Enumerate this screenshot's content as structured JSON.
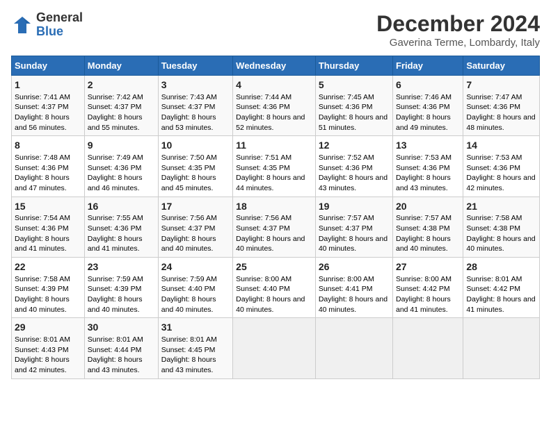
{
  "logo": {
    "general": "General",
    "blue": "Blue"
  },
  "title": "December 2024",
  "subtitle": "Gaverina Terme, Lombardy, Italy",
  "days_header": [
    "Sunday",
    "Monday",
    "Tuesday",
    "Wednesday",
    "Thursday",
    "Friday",
    "Saturday"
  ],
  "weeks": [
    [
      {
        "day": "1",
        "sunrise": "7:41 AM",
        "sunset": "4:37 PM",
        "daylight": "8 hours and 56 minutes."
      },
      {
        "day": "2",
        "sunrise": "7:42 AM",
        "sunset": "4:37 PM",
        "daylight": "8 hours and 55 minutes."
      },
      {
        "day": "3",
        "sunrise": "7:43 AM",
        "sunset": "4:37 PM",
        "daylight": "8 hours and 53 minutes."
      },
      {
        "day": "4",
        "sunrise": "7:44 AM",
        "sunset": "4:36 PM",
        "daylight": "8 hours and 52 minutes."
      },
      {
        "day": "5",
        "sunrise": "7:45 AM",
        "sunset": "4:36 PM",
        "daylight": "8 hours and 51 minutes."
      },
      {
        "day": "6",
        "sunrise": "7:46 AM",
        "sunset": "4:36 PM",
        "daylight": "8 hours and 49 minutes."
      },
      {
        "day": "7",
        "sunrise": "7:47 AM",
        "sunset": "4:36 PM",
        "daylight": "8 hours and 48 minutes."
      }
    ],
    [
      {
        "day": "8",
        "sunrise": "7:48 AM",
        "sunset": "4:36 PM",
        "daylight": "8 hours and 47 minutes."
      },
      {
        "day": "9",
        "sunrise": "7:49 AM",
        "sunset": "4:36 PM",
        "daylight": "8 hours and 46 minutes."
      },
      {
        "day": "10",
        "sunrise": "7:50 AM",
        "sunset": "4:35 PM",
        "daylight": "8 hours and 45 minutes."
      },
      {
        "day": "11",
        "sunrise": "7:51 AM",
        "sunset": "4:35 PM",
        "daylight": "8 hours and 44 minutes."
      },
      {
        "day": "12",
        "sunrise": "7:52 AM",
        "sunset": "4:36 PM",
        "daylight": "8 hours and 43 minutes."
      },
      {
        "day": "13",
        "sunrise": "7:53 AM",
        "sunset": "4:36 PM",
        "daylight": "8 hours and 43 minutes."
      },
      {
        "day": "14",
        "sunrise": "7:53 AM",
        "sunset": "4:36 PM",
        "daylight": "8 hours and 42 minutes."
      }
    ],
    [
      {
        "day": "15",
        "sunrise": "7:54 AM",
        "sunset": "4:36 PM",
        "daylight": "8 hours and 41 minutes."
      },
      {
        "day": "16",
        "sunrise": "7:55 AM",
        "sunset": "4:36 PM",
        "daylight": "8 hours and 41 minutes."
      },
      {
        "day": "17",
        "sunrise": "7:56 AM",
        "sunset": "4:37 PM",
        "daylight": "8 hours and 40 minutes."
      },
      {
        "day": "18",
        "sunrise": "7:56 AM",
        "sunset": "4:37 PM",
        "daylight": "8 hours and 40 minutes."
      },
      {
        "day": "19",
        "sunrise": "7:57 AM",
        "sunset": "4:37 PM",
        "daylight": "8 hours and 40 minutes."
      },
      {
        "day": "20",
        "sunrise": "7:57 AM",
        "sunset": "4:38 PM",
        "daylight": "8 hours and 40 minutes."
      },
      {
        "day": "21",
        "sunrise": "7:58 AM",
        "sunset": "4:38 PM",
        "daylight": "8 hours and 40 minutes."
      }
    ],
    [
      {
        "day": "22",
        "sunrise": "7:58 AM",
        "sunset": "4:39 PM",
        "daylight": "8 hours and 40 minutes."
      },
      {
        "day": "23",
        "sunrise": "7:59 AM",
        "sunset": "4:39 PM",
        "daylight": "8 hours and 40 minutes."
      },
      {
        "day": "24",
        "sunrise": "7:59 AM",
        "sunset": "4:40 PM",
        "daylight": "8 hours and 40 minutes."
      },
      {
        "day": "25",
        "sunrise": "8:00 AM",
        "sunset": "4:40 PM",
        "daylight": "8 hours and 40 minutes."
      },
      {
        "day": "26",
        "sunrise": "8:00 AM",
        "sunset": "4:41 PM",
        "daylight": "8 hours and 40 minutes."
      },
      {
        "day": "27",
        "sunrise": "8:00 AM",
        "sunset": "4:42 PM",
        "daylight": "8 hours and 41 minutes."
      },
      {
        "day": "28",
        "sunrise": "8:01 AM",
        "sunset": "4:42 PM",
        "daylight": "8 hours and 41 minutes."
      }
    ],
    [
      {
        "day": "29",
        "sunrise": "8:01 AM",
        "sunset": "4:43 PM",
        "daylight": "8 hours and 42 minutes."
      },
      {
        "day": "30",
        "sunrise": "8:01 AM",
        "sunset": "4:44 PM",
        "daylight": "8 hours and 43 minutes."
      },
      {
        "day": "31",
        "sunrise": "8:01 AM",
        "sunset": "4:45 PM",
        "daylight": "8 hours and 43 minutes."
      },
      null,
      null,
      null,
      null
    ]
  ],
  "labels": {
    "sunrise": "Sunrise:",
    "sunset": "Sunset:",
    "daylight": "Daylight:"
  }
}
